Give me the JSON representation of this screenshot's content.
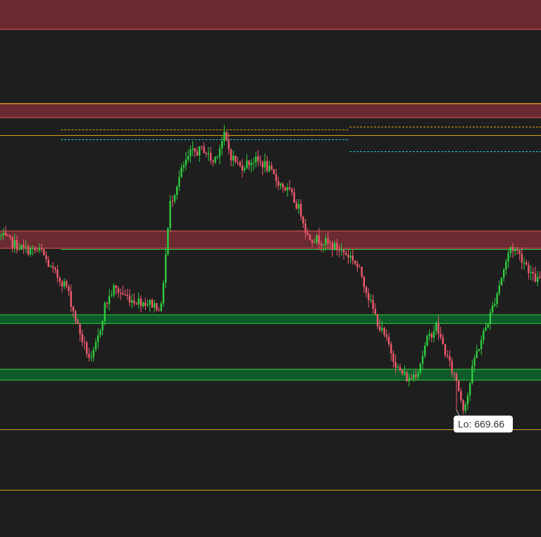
{
  "colors": {
    "background": "#1e1e1e",
    "up_candle": "#2ecc40",
    "down_candle": "#f05a6e",
    "resistance_zone_fill": "#6b2a32",
    "resistance_zone_edge": "#e05858",
    "support_zone_fill": "#0d5a2a",
    "support_zone_edge": "#2ecc40",
    "level_line": "#d4a017",
    "dashed_orange": "#d4a017",
    "dashed_cyan": "#20c8d8",
    "thin_green": "#2ecc40",
    "label_bg": "#ffffff",
    "label_text": "#333333"
  },
  "chart_data": {
    "type": "candlestick",
    "ylim": [
      658,
      707.3
    ],
    "x_count": 240,
    "resistance_zones": [
      {
        "from": 704.6,
        "to": 707.3
      },
      {
        "from": 696.5,
        "to": 697.8
      },
      {
        "from": 684.5,
        "to": 686.1
      }
    ],
    "support_zones": [
      {
        "from": 677.6,
        "to": 678.4
      },
      {
        "from": 672.4,
        "to": 673.4
      }
    ],
    "level_lines": [
      697.8,
      694.9,
      667.9,
      662.3
    ],
    "dashed_levels": [
      {
        "price": 695.4,
        "x_from": 27,
        "x_to": 155,
        "color": "orange"
      },
      {
        "price": 694.5,
        "x_from": 27,
        "x_to": 155,
        "color": "cyan"
      },
      {
        "price": 695.7,
        "x_from": 155,
        "x_to": 240,
        "color": "orange"
      },
      {
        "price": 693.4,
        "x_from": 155,
        "x_to": 240,
        "color": "cyan"
      }
    ],
    "thin_green_line": {
      "price": 684.4,
      "x_from": 27,
      "x_to": 240
    },
    "low_label": {
      "text": "Lo: 669.66",
      "price": 669.66
    },
    "path_points": [
      [
        0,
        685.6
      ],
      [
        10,
        684.4
      ],
      [
        18,
        684.2
      ],
      [
        22,
        682.6
      ],
      [
        29,
        681.0
      ],
      [
        34,
        677.3
      ],
      [
        37,
        675.5
      ],
      [
        40,
        674.1
      ],
      [
        43,
        676.3
      ],
      [
        46,
        679.2
      ],
      [
        50,
        680.8
      ],
      [
        58,
        679.8
      ],
      [
        67,
        679.4
      ],
      [
        71,
        679.0
      ],
      [
        72,
        681.6
      ],
      [
        75,
        688.6
      ],
      [
        80,
        691.6
      ],
      [
        84,
        693.2
      ],
      [
        90,
        693.6
      ],
      [
        94,
        692.4
      ],
      [
        99,
        694.8
      ],
      [
        102,
        693.0
      ],
      [
        106,
        692.0
      ],
      [
        112,
        692.6
      ],
      [
        117,
        692.2
      ],
      [
        122,
        690.8
      ],
      [
        128,
        689.6
      ],
      [
        133,
        687.8
      ],
      [
        136,
        685.6
      ],
      [
        142,
        685.2
      ],
      [
        150,
        684.4
      ],
      [
        156,
        683.6
      ],
      [
        160,
        682.0
      ],
      [
        164,
        679.4
      ],
      [
        168,
        677.2
      ],
      [
        172,
        675.6
      ],
      [
        176,
        673.4
      ],
      [
        181,
        672.4
      ],
      [
        185,
        673.4
      ],
      [
        189,
        676.1
      ],
      [
        193,
        677.4
      ],
      [
        196,
        675.6
      ],
      [
        199,
        673.8
      ],
      [
        202,
        672.4
      ],
      [
        205,
        669.9
      ],
      [
        207,
        671.1
      ],
      [
        210,
        674.4
      ],
      [
        213,
        676.1
      ],
      [
        217,
        678.4
      ],
      [
        220,
        680.5
      ],
      [
        223,
        682.6
      ],
      [
        226,
        684.6
      ],
      [
        229,
        684.2
      ],
      [
        233,
        683.0
      ],
      [
        236,
        681.8
      ],
      [
        239,
        681.5
      ]
    ]
  }
}
